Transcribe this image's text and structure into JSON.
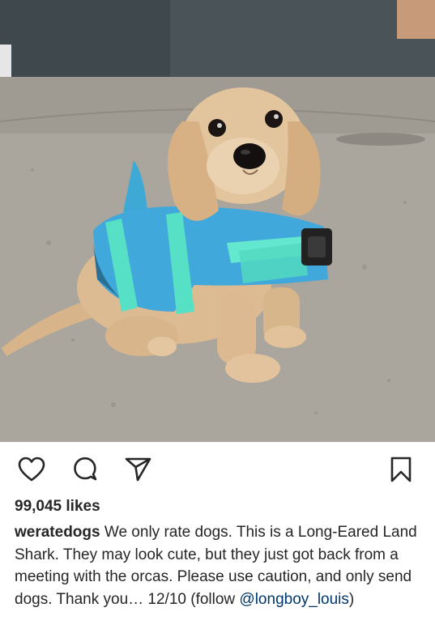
{
  "post": {
    "image_alt": "Long-eared dachshund puppy wearing a blue shark life jacket",
    "likes": "99,045 likes",
    "caption": {
      "username": "weratedogs",
      "text": " We only rate dogs. This is a Long-Eared Land Shark. They may look cute, but they just got back from a meeting with the orcas. Please use caution, and only send dogs. Thank you… 12/10 (follow ",
      "mention": "@longboy_louis",
      "close": ")"
    }
  },
  "icons": {
    "like": "heart-icon",
    "comment": "comment-icon",
    "share": "paper-plane-icon",
    "save": "bookmark-icon"
  },
  "colors": {
    "text": "#262626",
    "mention": "#00376b",
    "background": "#ffffff"
  }
}
